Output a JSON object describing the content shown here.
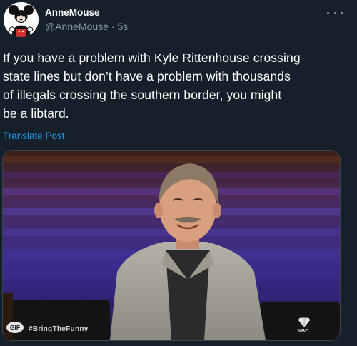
{
  "author": {
    "display_name": "AnneMouse",
    "handle": "@AnneMouse",
    "separator": "·",
    "time": "5s",
    "avatar_icon": "mickey-mouse-icon"
  },
  "tweet": {
    "text": "If you have a problem with Kyle Rittenhouse crossing\nstate lines but don’t have a problem with thousands\nof illegals crossing the southern border, you might\nbe a libtard.",
    "translate_label": "Translate Post"
  },
  "media": {
    "type": "gif",
    "badge": "GIF",
    "caption": "#BringTheFunny",
    "network": "NBC"
  },
  "colors": {
    "background": "#15202b",
    "text": "#ffffff",
    "secondary_text": "#8b98a5",
    "link": "#1d9bf0"
  }
}
